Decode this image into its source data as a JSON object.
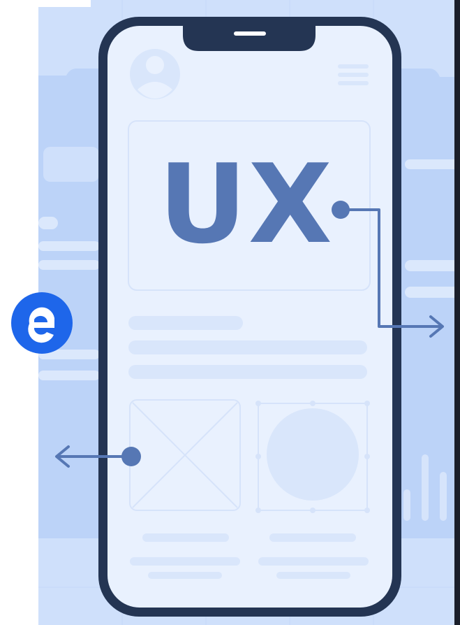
{
  "hero": {
    "text": "UX"
  },
  "badge": {
    "name": "brand-logo-icon"
  },
  "colors": {
    "background": "#cfe0fb",
    "phone_frame": "#243553",
    "screen": "#e9f1fe",
    "wireframe": "#d9e6fb",
    "accent": "#5677b4",
    "badge": "#1e66ea"
  }
}
